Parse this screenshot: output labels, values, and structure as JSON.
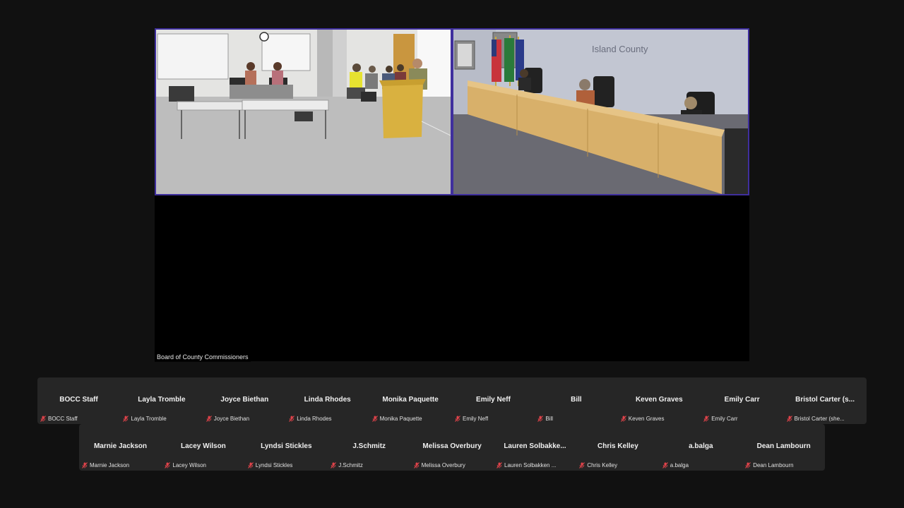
{
  "meeting": {
    "feed_label": "Board of County Commissioners",
    "room_sign": "Island County"
  },
  "participants_row1": [
    {
      "name": "BOCC Staff",
      "label": "BOCC Staff",
      "muted": true
    },
    {
      "name": "Layla Tromble",
      "label": "Layla Tromble",
      "muted": true
    },
    {
      "name": "Joyce Biethan",
      "label": "Joyce Biethan",
      "muted": true
    },
    {
      "name": "Linda Rhodes",
      "label": "Linda Rhodes",
      "muted": true
    },
    {
      "name": "Monika Paquette",
      "label": "Monika Paquette",
      "muted": true
    },
    {
      "name": "Emily Neff",
      "label": "Emily Neff",
      "muted": true
    },
    {
      "name": "Bill",
      "label": "Bill",
      "muted": true
    },
    {
      "name": "Keven Graves",
      "label": "Keven Graves",
      "muted": true
    },
    {
      "name": "Emily Carr",
      "label": "Emily Carr",
      "muted": true
    },
    {
      "name": "Bristol Carter (s...",
      "label": "Bristol Carter (she...",
      "muted": true
    }
  ],
  "participants_row2": [
    {
      "name": "Marnie Jackson",
      "label": "Marnie Jackson",
      "muted": true
    },
    {
      "name": "Lacey Wilson",
      "label": "Lacey Wilson",
      "muted": true
    },
    {
      "name": "Lyndsi Stickles",
      "label": "Lyndsi Stickles",
      "muted": true
    },
    {
      "name": "J.Schmitz",
      "label": "J.Schmitz",
      "muted": true
    },
    {
      "name": "Melissa Overbury",
      "label": "Melissa Overbury",
      "muted": true
    },
    {
      "name": "Lauren  Solbakke...",
      "label": "Lauren Solbakken ...",
      "muted": true
    },
    {
      "name": "Chris Kelley",
      "label": "Chris Kelley",
      "muted": true
    },
    {
      "name": "a.balga",
      "label": "a.balga",
      "muted": true
    },
    {
      "name": "Dean Lambourn",
      "label": "Dean Lambourn",
      "muted": true
    }
  ],
  "icons": {
    "muted_mic": "muted-mic-icon"
  },
  "colors": {
    "active_speaker_border": "#3f2f9e",
    "muted_icon": "#e0434a",
    "strip_bg": "#262626"
  }
}
